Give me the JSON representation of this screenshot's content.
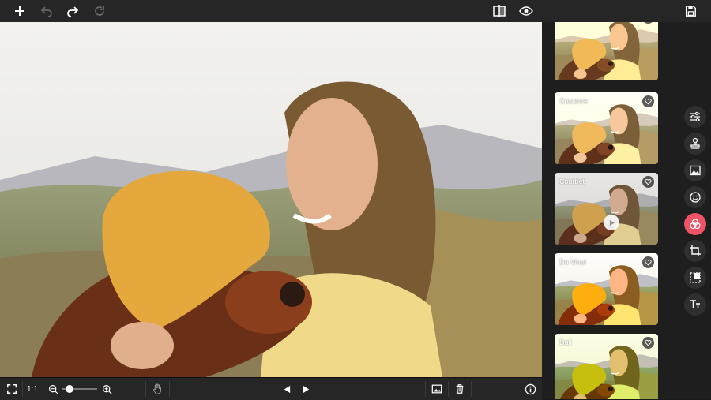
{
  "bottombar": {
    "zoom_reset_label": "1:1",
    "zoom_level": 0.2
  },
  "filters": [
    {
      "name": ""
    },
    {
      "name": "Cézanne"
    },
    {
      "name": "Courbet"
    },
    {
      "name": "Da Vinci"
    },
    {
      "name": "Dali"
    }
  ],
  "colors": {
    "accent": "#ee5366",
    "toolbar_bg": "#262626",
    "panel_bg": "#1e1e1e"
  },
  "icons": {
    "topbar": [
      "plus-icon",
      "undo-icon",
      "redo-icon",
      "refresh-icon",
      "compare-icon",
      "eye-icon",
      "save-icon"
    ],
    "tools": [
      "sliders-icon",
      "stamp-icon",
      "image-icon",
      "smiley-icon",
      "filters-icon",
      "crop-icon",
      "resize-icon",
      "text-icon"
    ],
    "bottombar": [
      "fullscreen-icon",
      "zoom-out-icon",
      "zoom-in-icon",
      "hand-icon",
      "prev-icon",
      "next-icon",
      "image-icon",
      "trash-icon",
      "info-icon"
    ]
  }
}
